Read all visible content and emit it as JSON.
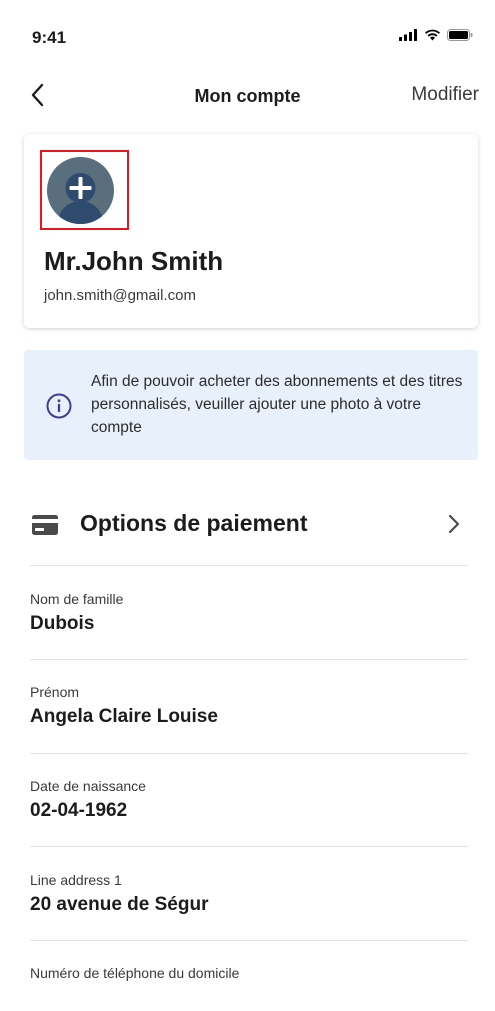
{
  "status_bar": {
    "time": "9:41"
  },
  "nav": {
    "title": "Mon compte",
    "edit_label": "Modifier"
  },
  "profile": {
    "name": "Mr.John Smith",
    "email": "john.smith@gmail.com"
  },
  "info_banner": {
    "text": "Afin de pouvoir acheter des abonnements et des titres personnalisés, veuiller ajouter une photo à votre compte"
  },
  "payment": {
    "label": "Options de paiement"
  },
  "fields": [
    {
      "label": "Nom de famille",
      "value": "Dubois"
    },
    {
      "label": "Prénom",
      "value": "Angela Claire Louise"
    },
    {
      "label": "Date de naissance",
      "value": "02-04-1962"
    },
    {
      "label": "Line address 1",
      "value": "20 avenue de Ségur"
    },
    {
      "label": "Numéro de téléphone du domicile",
      "value": ""
    }
  ],
  "colors": {
    "highlight": "#e8161b",
    "avatar": "#5a6f7e",
    "banner_bg": "#e8f0fb",
    "info_icon": "#3b3f8f"
  },
  "icons": [
    "signal-icon",
    "wifi-icon",
    "battery-icon",
    "back-chevron-icon",
    "add-user-avatar-icon",
    "info-icon",
    "credit-card-icon",
    "chevron-right-icon"
  ]
}
